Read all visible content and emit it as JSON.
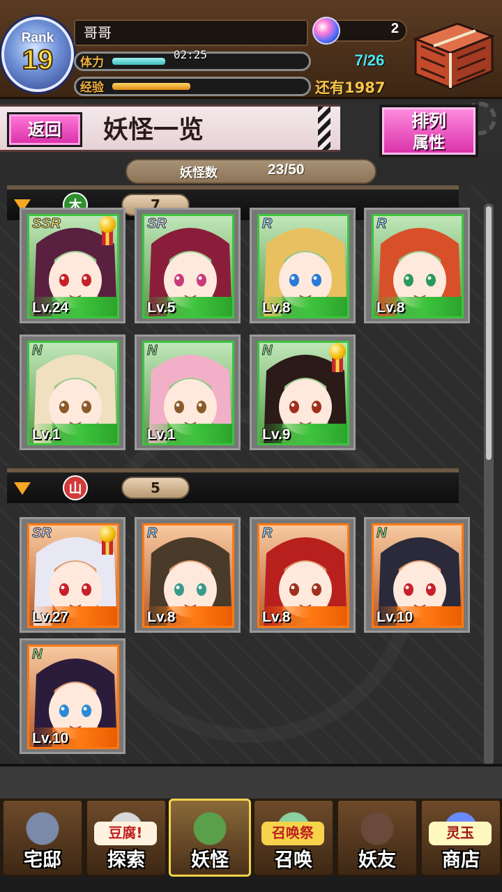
{
  "header": {
    "rank_label": "Rank",
    "rank_value": "19",
    "player_name": "哥哥",
    "stamina_label": "体力",
    "stamina_timer": "02:25",
    "stamina_count": "7/26",
    "stamina_fraction": 0.27,
    "exp_label": "经验",
    "exp_remaining": "还有1987",
    "exp_fraction": 0.4,
    "gem_count": "2"
  },
  "title_bar": {
    "back_label": "返回",
    "page_title": "妖怪一览",
    "sort_line1": "排列",
    "sort_line2": "属性"
  },
  "summary": {
    "count_label": "妖怪数",
    "count_value": "23/50"
  },
  "sections": [
    {
      "attribute": "木",
      "attribute_color": "#2f8f2f",
      "count": "7",
      "frame_color": "green",
      "cards": [
        {
          "rarity": "SSR",
          "level": "Lv.24",
          "medal": true
        },
        {
          "rarity": "SR",
          "level": "Lv.5",
          "medal": false
        },
        {
          "rarity": "R",
          "level": "Lv.8",
          "medal": false
        },
        {
          "rarity": "R",
          "level": "Lv.8",
          "medal": false
        },
        {
          "rarity": "N",
          "level": "Lv.1",
          "medal": false
        },
        {
          "rarity": "N",
          "level": "Lv.1",
          "medal": false
        },
        {
          "rarity": "N",
          "level": "Lv.9",
          "medal": true
        }
      ]
    },
    {
      "attribute": "山",
      "attribute_color": "#d23a3a",
      "count": "5",
      "frame_color": "orange",
      "cards": [
        {
          "rarity": "SR",
          "level": "Lv.27",
          "medal": true
        },
        {
          "rarity": "R",
          "level": "Lv.8",
          "medal": false
        },
        {
          "rarity": "R",
          "level": "Lv.8",
          "medal": false
        },
        {
          "rarity": "N",
          "level": "Lv.10",
          "medal": false
        },
        {
          "rarity": "N",
          "level": "Lv.10",
          "medal": false
        }
      ]
    }
  ],
  "nav": [
    {
      "label": "宅邸",
      "icon": "mansion-icon"
    },
    {
      "label": "探索",
      "icon": "tofu-explore-icon",
      "tag": "豆腐!"
    },
    {
      "label": "妖怪",
      "icon": "scroll-icon",
      "active": true
    },
    {
      "label": "召唤",
      "icon": "summon-star-icon",
      "tag": "召唤祭"
    },
    {
      "label": "妖友",
      "icon": "catgirl-friend-icon"
    },
    {
      "label": "商店",
      "icon": "orb-shop-icon",
      "tag": "灵玉"
    }
  ],
  "colors": {
    "accent_pink": "#d92ea8",
    "wood_green": "#3ec43e",
    "fire_orange": "#ff7a14",
    "gold": "#f5d34a"
  }
}
